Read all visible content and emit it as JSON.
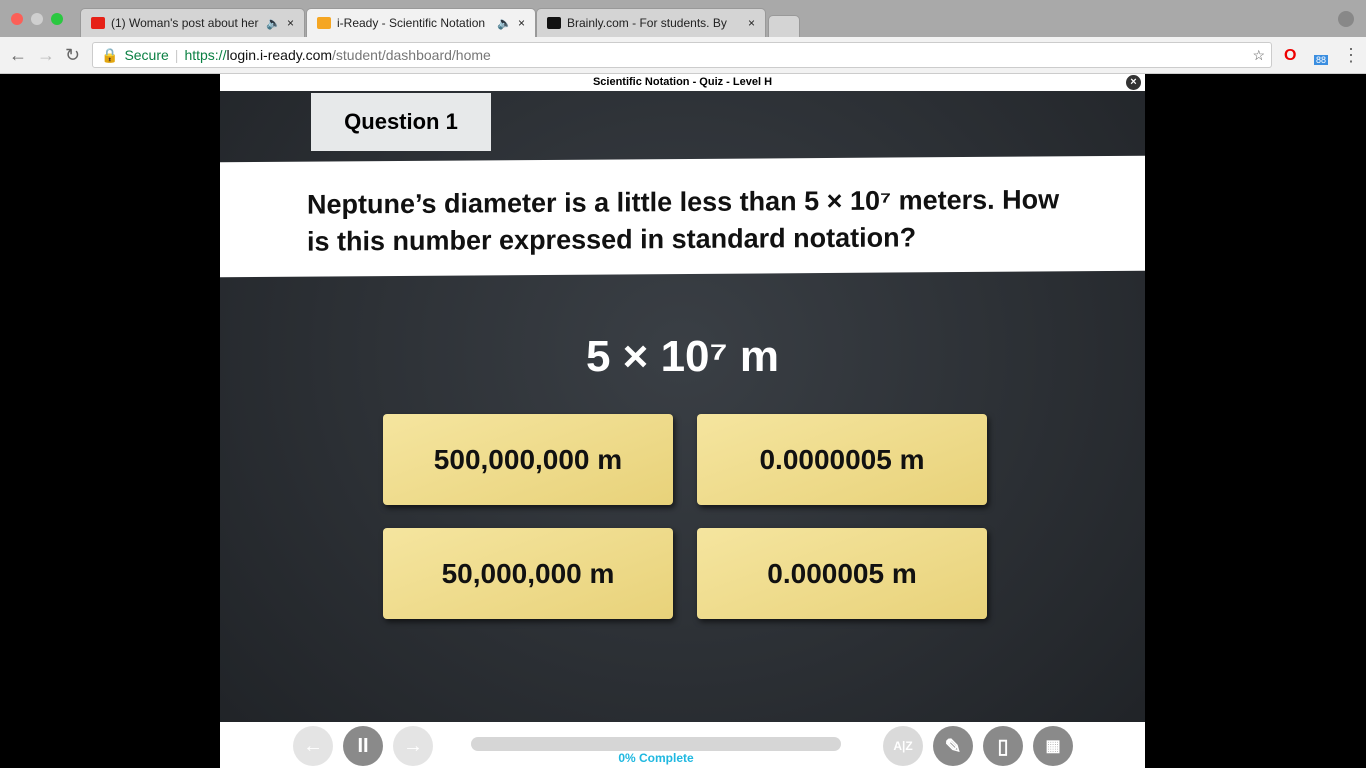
{
  "browser": {
    "tabs": [
      {
        "title": "(1) Woman's post about her",
        "color": "#e62117"
      },
      {
        "title": "i-Ready - Scientific Notation",
        "color": "#f5a623"
      },
      {
        "title": "Brainly.com - For students. By",
        "color": "#111111"
      }
    ],
    "secure_label": "Secure",
    "url_scheme": "https://",
    "url_host": "login.i-ready.com",
    "url_path": "/student/dashboard/home",
    "badge": "88"
  },
  "quiz": {
    "title": "Scientific Notation - Quiz - Level H",
    "question_label": "Question 1",
    "question": "Neptune’s diameter is a little less than 5 × 10⁷ meters. How is this number expressed in standard notation?",
    "expression": "5 × 10⁷ m",
    "answers": [
      "500,000,000 m",
      "0.0000005 m",
      "50,000,000 m",
      "0.000005 m"
    ],
    "progress_percent": 0,
    "progress_label": "0% Complete"
  }
}
